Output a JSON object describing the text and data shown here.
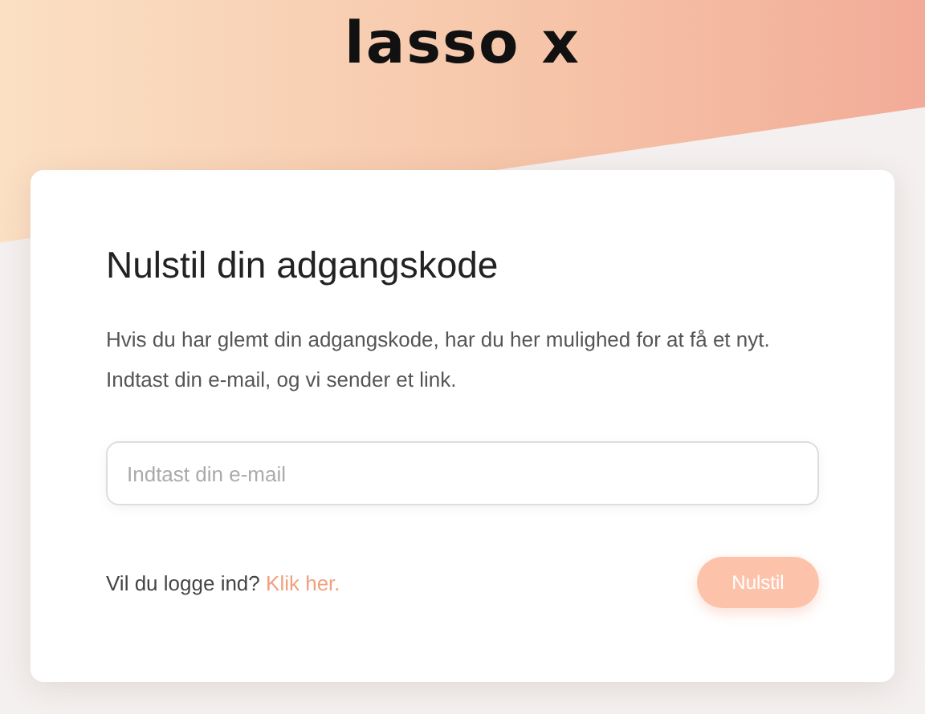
{
  "logo": "lasso x",
  "card": {
    "title": "Nulstil din adgangskode",
    "description": [
      "Hvis du har glemt din adgangskode, har du her mulighed for at få et nyt.",
      "Indtast din e-mail, og vi sender et link."
    ],
    "email_field": {
      "placeholder": "Indtast din e-mail"
    },
    "login_prompt": "Vil du logge ind?",
    "login_link": "Klik her.",
    "submit_button": {
      "label": "Nulstil",
      "disabled": true
    }
  }
}
